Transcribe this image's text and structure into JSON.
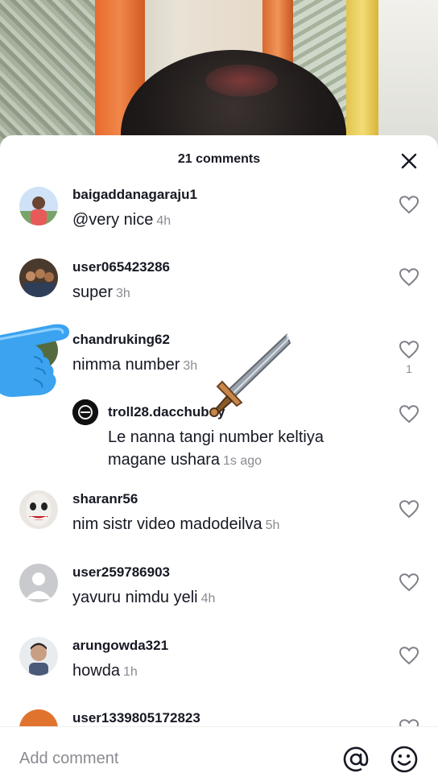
{
  "sheet": {
    "title": "21 comments",
    "close_icon": "close-icon"
  },
  "comments": [
    {
      "username": "baigaddanagaraju1",
      "text": "@very nice",
      "time": "4h",
      "likes": ""
    },
    {
      "username": "user065423286",
      "text": "super",
      "time": "3h",
      "likes": ""
    },
    {
      "username": "chandruking62",
      "text": "nimma number",
      "time": "3h",
      "likes": "1"
    },
    {
      "username": "troll28.dacchuboy",
      "text_line1": "Le nanna tangi number keltiya",
      "text_line2": "magane ushara",
      "time": "1s ago",
      "reply": true
    },
    {
      "username": "sharanr56",
      "text": "nim sistr video madodeilva",
      "time": "5h"
    },
    {
      "username": "user259786903",
      "text": "yavuru nimdu yeli",
      "time": "4h"
    },
    {
      "username": "arungowda321",
      "text": "howda",
      "time": "1h"
    },
    {
      "username": "user1339805172823",
      "text": "",
      "time": ""
    }
  ],
  "input": {
    "placeholder": "Add comment",
    "at_icon": "at-icon",
    "emoji_icon": "emoji-icon"
  },
  "colors": {
    "text_primary": "#161823",
    "text_secondary": "#8a8b91",
    "hand_blue": "#3ba3f0",
    "sword_blade": "#9aa3ad",
    "sword_hilt": "#c8874a"
  }
}
